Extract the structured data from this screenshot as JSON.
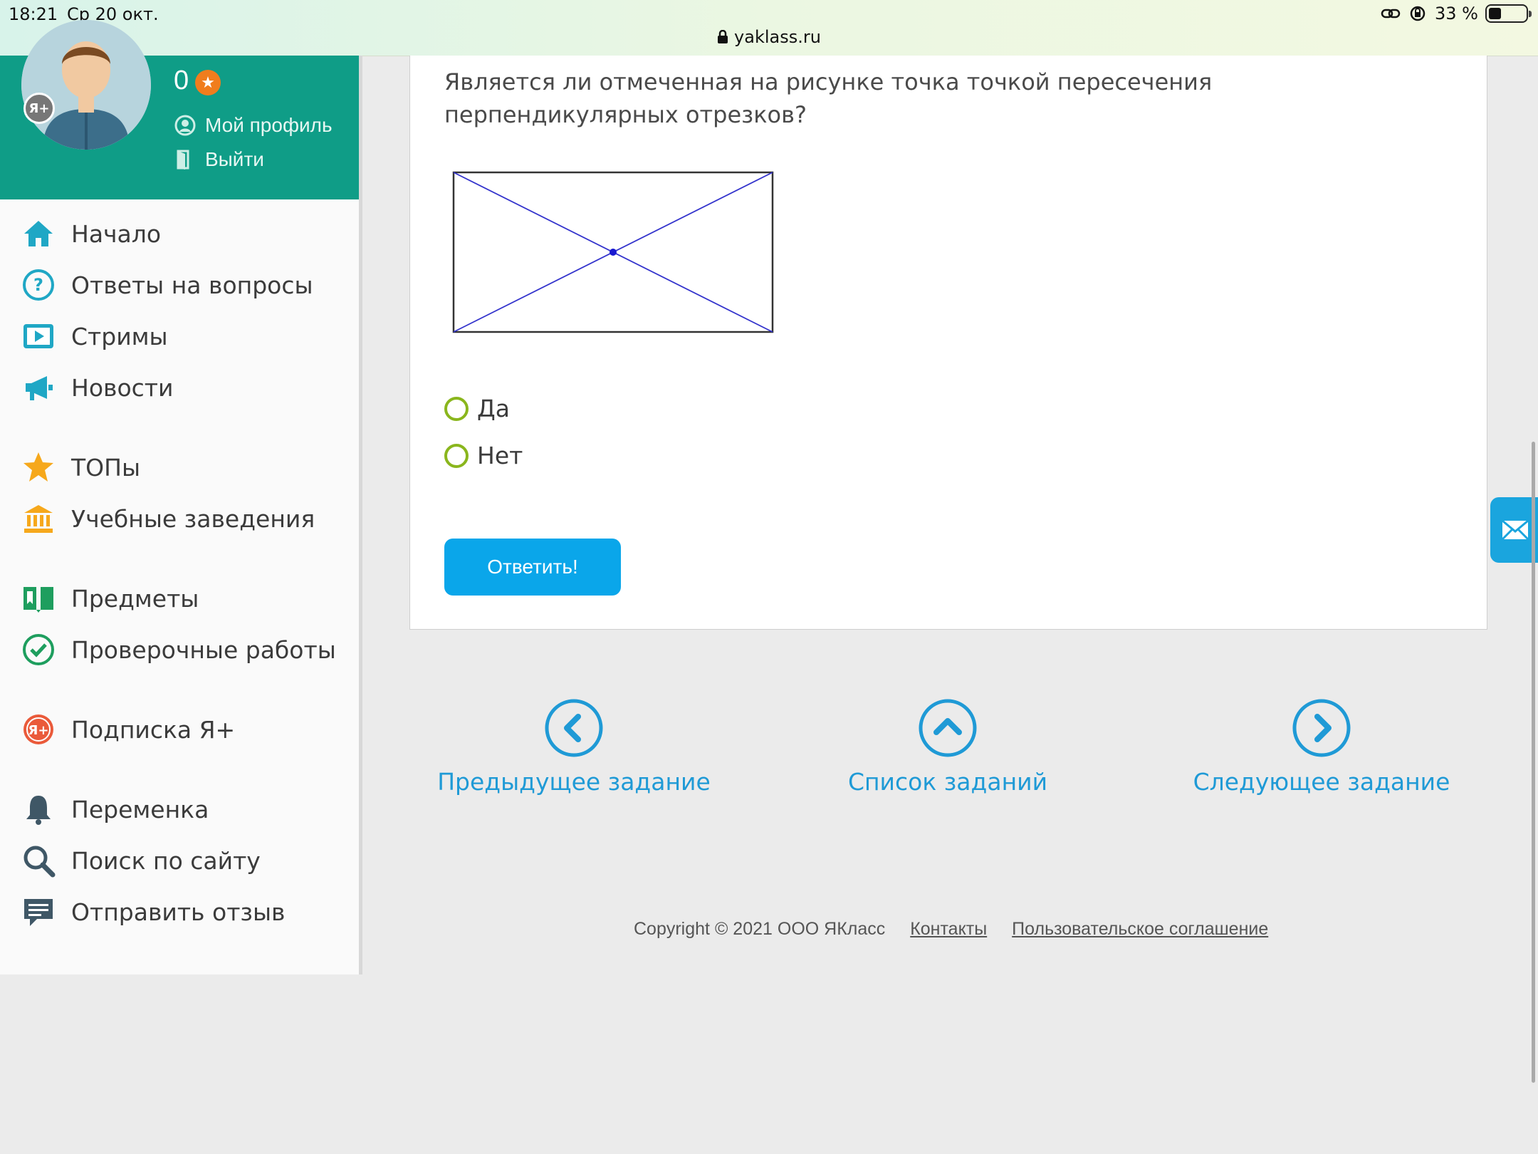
{
  "status_bar": {
    "time": "18:21",
    "date": "Ср 20 окт.",
    "battery": "33 %",
    "battery_level": 0.33,
    "url": "yaklass.ru",
    "icons": [
      "link-icon",
      "rotation-lock-icon",
      "battery-icon",
      "lock-icon"
    ]
  },
  "profile": {
    "points": "0",
    "badge": "Я+",
    "my_profile": "Мой профиль",
    "logout": "Выйти"
  },
  "sidebar": {
    "items": [
      {
        "label": "Начало",
        "icon": "home-icon"
      },
      {
        "label": "Ответы на вопросы",
        "icon": "question-icon"
      },
      {
        "label": "Стримы",
        "icon": "play-icon"
      },
      {
        "label": "Новости",
        "icon": "megaphone-icon"
      },
      {
        "label": "ТОПы",
        "icon": "star-icon"
      },
      {
        "label": "Учебные заведения",
        "icon": "institution-icon"
      },
      {
        "label": "Предметы",
        "icon": "book-icon"
      },
      {
        "label": "Проверочные работы",
        "icon": "check-circle-icon"
      },
      {
        "label": "Подписка Я+",
        "icon": "ya-plus-icon"
      },
      {
        "label": "Переменка",
        "icon": "bell-icon"
      },
      {
        "label": "Поиск по сайту",
        "icon": "search-icon"
      },
      {
        "label": "Отправить отзыв",
        "icon": "comment-icon"
      }
    ]
  },
  "task": {
    "question": "Является ли отмеченная на рисунке точка точкой пересечения перпендикулярных отрезков?",
    "options": [
      "Да",
      "Нет"
    ],
    "submit": "Ответить!"
  },
  "navigation": {
    "prev": "Предыдущее задание",
    "list": "Список заданий",
    "next": "Следующее задание"
  },
  "footer": {
    "copyright": "Copyright © 2021 ООО ЯКласс",
    "contacts": "Контакты",
    "agreement": "Пользовательское соглашение"
  },
  "colors": {
    "profile_bg": "#0f9d87",
    "accent_blue": "#1f9ad6",
    "button_blue": "#0aa6ea",
    "radio_green": "#8ab61d"
  }
}
